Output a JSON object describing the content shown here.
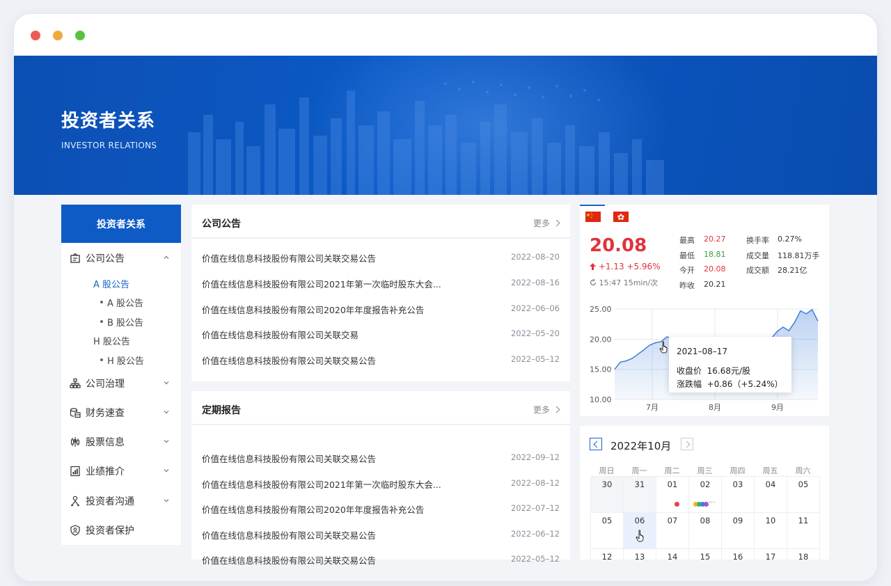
{
  "banner": {
    "title": "投资者关系",
    "subtitle": "INVESTOR RELATIONS"
  },
  "sidebar": {
    "header": "投资者关系",
    "groups": [
      {
        "label": "公司公告",
        "icon": "announcement-icon",
        "expanded": true
      },
      {
        "label": "公司治理",
        "icon": "org-chart-icon"
      },
      {
        "label": "财务速查",
        "icon": "coins-icon"
      },
      {
        "label": "股票信息",
        "icon": "candlestick-icon"
      },
      {
        "label": "业绩推介",
        "icon": "report-chart-icon"
      },
      {
        "label": "投资者沟通",
        "icon": "person-network-icon"
      },
      {
        "label": "投资者保护",
        "icon": "shield-person-icon"
      }
    ],
    "subs": {
      "a_shares": "A 股公告",
      "a_item": "A 股公告",
      "b_item": "B 股公告",
      "h_shares": "H 股公告",
      "h_item": "H 股公告"
    }
  },
  "announcements": {
    "title": "公司公告",
    "more": "更多",
    "items": [
      {
        "title": "价值在线信息科技股份有限公司关联交易公告",
        "date": "2022–08–20"
      },
      {
        "title": "价值在线信息科技股份有限公司2021年第一次临时股东大会...",
        "date": "2022–08–16"
      },
      {
        "title": "价值在线信息科技股份有限公司2020年年度报告补充公告",
        "date": "2022–06–06"
      },
      {
        "title": "价值在线信息科技股份有限公司关联交易",
        "date": "2022–05–20"
      },
      {
        "title": "价值在线信息科技股份有限公司关联交易公告",
        "date": "2022–05–12"
      }
    ]
  },
  "reports": {
    "title": "定期报告",
    "more": "更多",
    "items": [
      {
        "title": "价值在线信息科技股份有限公司关联交易公告",
        "date": "2022–09–12"
      },
      {
        "title": "价值在线信息科技股份有限公司2021年第一次临时股东大会...",
        "date": "2022–08–12"
      },
      {
        "title": "价值在线信息科技股份有限公司2020年年度报告补充公告",
        "date": "2022–07–12"
      },
      {
        "title": "价值在线信息科技股份有限公司关联交易公告",
        "date": "2022–06–12"
      },
      {
        "title": "价值在线信息科技股份有限公司关联交易公告",
        "date": "2022–05–12"
      }
    ]
  },
  "stock": {
    "price": "20.08",
    "change": "+1.13  +5.96%",
    "update": "15:47 15min/次",
    "stats": [
      {
        "label": "最高",
        "value": "20.27",
        "color": "#e1333c"
      },
      {
        "label": "最低",
        "value": "18.81",
        "color": "#3a9a3a"
      },
      {
        "label": "今开",
        "value": "20.08",
        "color": "#e1333c"
      },
      {
        "label": "昨收",
        "value": "20.21",
        "color": "#333333"
      },
      {
        "label": "换手率",
        "value": "0.27%",
        "color": "#333333"
      },
      {
        "label": "成交量",
        "value": "118.81万手",
        "color": "#333333"
      },
      {
        "label": "成交额",
        "value": "28.21亿",
        "color": "#333333"
      }
    ],
    "tooltip": {
      "date": "2021–08–17",
      "close_label": "收盘价",
      "close_value": "16.68元/股",
      "change_label": "涨跌幅",
      "change_value": "+0.86（+5.24%）"
    }
  },
  "chart_data": {
    "type": "area",
    "y_ticks": [
      "25.00",
      "20.00",
      "15.00",
      "10.00"
    ],
    "ylim": [
      10,
      25
    ],
    "x_ticks": [
      "7月",
      "8月",
      "9月"
    ],
    "series": [
      {
        "values": [
          15.0,
          16.2,
          16.4,
          16.8,
          17.5,
          18.2,
          19.0,
          19.4,
          19.6,
          20.4,
          20.1,
          19.3,
          18.8,
          18.2,
          17.9,
          17.5,
          17.2,
          16.8,
          16.4,
          16.0,
          16.2,
          16.6,
          17.0,
          17.4,
          18.0,
          18.8,
          19.5,
          20.2,
          21.3,
          22.0,
          21.4,
          22.8,
          24.7,
          24.2,
          24.9,
          23.0
        ],
        "color": "#3f7ed8"
      }
    ],
    "highlight_index": 11
  },
  "calendar": {
    "title": "2022年10月",
    "weekdays": [
      "周日",
      "周一",
      "周二",
      "周三",
      "周四",
      "周五",
      "周六"
    ],
    "rows": [
      [
        "30",
        "31",
        "01",
        "02",
        "03",
        "04",
        "05"
      ],
      [
        "05",
        "06",
        "07",
        "08",
        "09",
        "10",
        "11"
      ],
      [
        "12",
        "13",
        "14",
        "15",
        "16",
        "17",
        "18"
      ]
    ],
    "event_colors": [
      "#e8414b",
      "#f5b120",
      "#37b36b",
      "#3f7ed8",
      "#9b59d0",
      "#e8414b"
    ]
  }
}
